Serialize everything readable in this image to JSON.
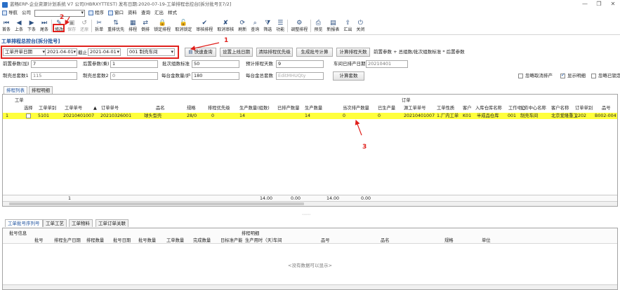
{
  "window": {
    "title": "蓝畅ERP-企业资源计划系统 V7 公司(HBRXYTTEST) 发布日期:2020-07-19-工单排程总控台[拆分批号][7/2]",
    "controls": {
      "minimize": "—",
      "restore": "❐",
      "close": "✕"
    }
  },
  "menubar": {
    "nav_label": "导航",
    "company_label": "公司",
    "items": [
      "程序",
      "窗口",
      "资料",
      "查询",
      "汇出",
      "样式"
    ]
  },
  "toolbar": {
    "buttons": [
      {
        "label": "首条",
        "glyph": "⏮",
        "enabled": true,
        "icon": "first-record-icon"
      },
      {
        "label": "上条",
        "glyph": "◀",
        "enabled": true,
        "icon": "prev-record-icon"
      },
      {
        "label": "下条",
        "glyph": "▶",
        "enabled": true,
        "icon": "next-record-icon"
      },
      {
        "label": "尾条",
        "glyph": "⏭",
        "enabled": true,
        "icon": "last-record-icon"
      },
      {
        "label": "修改",
        "glyph": "✎",
        "enabled": true,
        "icon": "edit-icon"
      },
      {
        "label": "保存",
        "glyph": "▣",
        "enabled": false,
        "icon": "save-icon"
      },
      {
        "label": "还原",
        "glyph": "↺",
        "enabled": false,
        "icon": "undo-icon"
      },
      {
        "label": "拆单",
        "glyph": "✂",
        "enabled": true,
        "icon": "split-order-icon"
      },
      {
        "label": "重排优先",
        "glyph": "⇅",
        "enabled": true,
        "icon": "reorder-priority-icon"
      },
      {
        "label": "排程",
        "glyph": "▦",
        "enabled": true,
        "icon": "schedule-icon"
      },
      {
        "label": "倒排",
        "glyph": "⇄",
        "enabled": true,
        "icon": "reverse-schedule-icon"
      },
      {
        "label": "锁定排程",
        "glyph": "🔒",
        "enabled": true,
        "icon": "lock-schedule-icon"
      },
      {
        "label": "取消锁定",
        "glyph": "🔓",
        "enabled": true,
        "icon": "unlock-icon"
      },
      {
        "label": "审核排程",
        "glyph": "✔",
        "enabled": true,
        "icon": "approve-schedule-icon"
      },
      {
        "label": "取消审核",
        "glyph": "✘",
        "enabled": true,
        "icon": "cancel-approve-icon"
      },
      {
        "label": "刷新",
        "glyph": "⟳",
        "enabled": true,
        "icon": "refresh-icon"
      },
      {
        "label": "查询",
        "glyph": "⌕",
        "enabled": true,
        "icon": "query-icon"
      },
      {
        "label": "筛选",
        "glyph": "⧩",
        "enabled": true,
        "icon": "filter-icon"
      },
      {
        "label": "功能",
        "glyph": "☰",
        "enabled": true,
        "icon": "function-menu-icon"
      },
      {
        "label": "调整排程",
        "glyph": "⚙",
        "enabled": true,
        "icon": "adjust-schedule-icon"
      },
      {
        "label": "预览",
        "glyph": "⎙",
        "enabled": true,
        "icon": "preview-icon"
      },
      {
        "label": "新报表",
        "glyph": "▤",
        "enabled": true,
        "icon": "new-report-icon"
      },
      {
        "label": "汇出",
        "glyph": "⇪",
        "enabled": true,
        "icon": "export-icon"
      },
      {
        "label": "关闭",
        "glyph": "⏻",
        "enabled": true,
        "icon": "close-window-icon"
      }
    ]
  },
  "page_title": "工单排程总控台[拆分批号]",
  "filters": {
    "date_type": "工单开单日期",
    "date_from": "2021-04-01",
    "to_label": "截止",
    "date_to": "2021-04-01",
    "workshop": "001 制壳车间",
    "btn_quick_query": "快速查询",
    "btn_set_last_date": "设置上线日期",
    "btn_clear_priority": "清除排程优先级",
    "btn_gen_batch": "生成批号计算",
    "btn_calc_days": "计算排程天数",
    "formula_text": "前置参数 + 总组数/批次组数标准 * 后置参数",
    "pre_param_label": "前置参数(加)",
    "pre_param_value": "7",
    "post_param_label": "后置参数(乘)",
    "post_param_value": "1",
    "batch_std_label": "批次组数标准",
    "batch_std_value": "50",
    "est_days_label": "预计排程天数",
    "est_days_value": "9",
    "last_date_label": "车间已排产日期",
    "last_date_value": "20210401",
    "shell_total1_label": "制壳总套数1",
    "shell_total1_value": "115",
    "shell_total2_label": "制壳总套数2",
    "shell_total2_value": "0",
    "shell_qty_label": "每台金数量/炉",
    "shell_qty_value": "180",
    "group_total_label": "每台金总套数",
    "group_total_placeholder": "EditMHUQty",
    "btn_calc_groups": "计算套数",
    "chk_ignore_cancel": "忽略取消排产",
    "chk_show_detail": "显示明细",
    "chk_ignore_locked": "忽略已锁定"
  },
  "tabs_top": [
    "排程列表",
    "排程明细"
  ],
  "grid": {
    "group_left": "工单",
    "group_right": "订单",
    "columns": [
      "选择",
      "工单单别",
      "工单单号",
      "订单单号",
      "品名",
      "规格",
      "排程优先级",
      "生产数量(组数)",
      "已排产数量",
      "生产数量",
      "当次排产数量",
      "已生产量",
      "源工单单号",
      "工单性质",
      "客户",
      "入库仓库名称",
      "工作中心",
      "工作中心名称",
      "客户名称",
      "订单单别",
      "品号"
    ],
    "rows": [
      {
        "no": "1",
        "type": "5101",
        "wo": "20210401007",
        "so": "20210326001",
        "name": "球头型壳",
        "spec": "28/0",
        "prio": "0",
        "qty_groups": "14",
        "scheduled": "",
        "qty": "14",
        "this_qty": "0",
        "produced": "0",
        "src_wo": "20210401007",
        "nature": "1.厂内工单",
        "customer": "K01",
        "warehouse": "半成品仓库",
        "wc": "001",
        "wc_name": "制壳车间",
        "cust_name": "北京爱隆重工",
        "so_type": "2202",
        "item": "B002-004"
      }
    ],
    "summary": {
      "count": "1",
      "qty_groups": "14.00",
      "scheduled": "0.00",
      "qty": "14.00",
      "this_qty": "0.00"
    }
  },
  "tabs_bottom": [
    "工单批号序列号",
    "工单工艺",
    "工单物料",
    "工单订单关联"
  ],
  "bottom": {
    "left_group": "批号信息",
    "right_group": "排程明细",
    "columns": [
      "批号",
      "排程生产日期",
      "排程数量",
      "批号日期",
      "批号数量",
      "工单数量",
      "完成数量",
      "日标准产能",
      "生产用时（天）",
      "车间",
      "品号",
      "品名",
      "规格",
      "单位"
    ],
    "empty_text": "<没有数据可以显示>"
  },
  "annotations": {
    "n1": "1",
    "n2": "2",
    "n3": "3"
  },
  "colors": {
    "highlight_row": "#ffff3c",
    "annotation": "#e0201c",
    "title_blue": "#1a4f9c"
  }
}
